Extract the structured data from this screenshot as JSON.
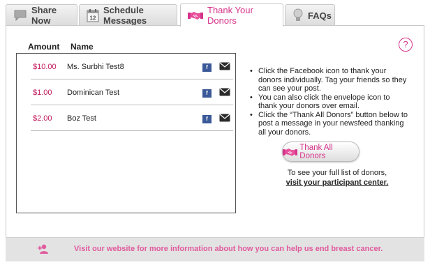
{
  "tabs": [
    {
      "label": "Share Now",
      "icon": "speech-bubble-icon"
    },
    {
      "label": "Schedule Messages",
      "icon": "calendar-icon",
      "icon_text": "12"
    },
    {
      "label": "Thank Your Donors",
      "icon": "handshake-icon",
      "active": true
    },
    {
      "label": "FAQs",
      "icon": "lightbulb-icon"
    }
  ],
  "help_icon": "?",
  "donor_table": {
    "headers": {
      "amount": "Amount",
      "name": "Name"
    },
    "rows": [
      {
        "amount": "$10.00",
        "name": "Ms. Surbhi Test8"
      },
      {
        "amount": "$1.00",
        "name": "Dominican Test"
      },
      {
        "amount": "$2.00",
        "name": "Boz Test"
      }
    ],
    "facebook_glyph": "f"
  },
  "instructions": [
    "Click the Facebook icon to thank your donors individually. Tag your friends so they can see your post.",
    "You can also click the envelope icon to thank your donors over email.",
    "Click the “Thank All Donors” button below to post a message in your newsfeed thanking all your donors."
  ],
  "thank_all_button": "Thank All Donors",
  "participant": {
    "note": "To see your full list of donors,",
    "link": "visit your participant center."
  },
  "footer": {
    "text": "Visit our website for more information about how you can help us end breast cancer.",
    "icon": "add-user-icon"
  },
  "colors": {
    "accent_pink": "#d6338a",
    "amount_pink": "#c2185b",
    "footer_text": "#e05a9c",
    "facebook_blue": "#3b5998"
  }
}
